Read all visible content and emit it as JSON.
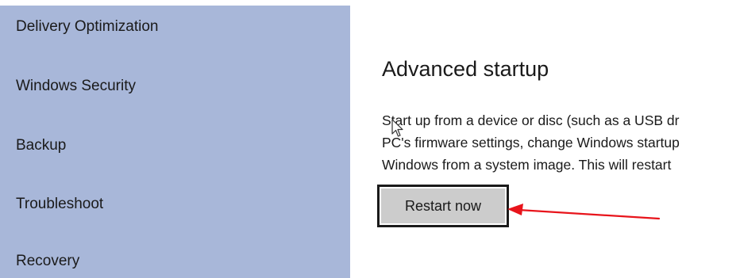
{
  "sidebar": {
    "items": [
      {
        "label": "Delivery Optimization"
      },
      {
        "label": "Windows Security"
      },
      {
        "label": "Backup"
      },
      {
        "label": "Troubleshoot"
      },
      {
        "label": "Recovery"
      }
    ]
  },
  "main": {
    "section_title": "Advanced startup",
    "description_lines": [
      "Start up from a device or disc (such as a USB dr",
      "PC's firmware settings, change Windows startup",
      "Windows from a system image. This will restart"
    ],
    "restart_button_label": "Restart now"
  },
  "colors": {
    "sidebar_background": "#a8b7d9",
    "annotation_arrow": "#e8141b",
    "button_background": "#cccccc"
  },
  "icons": {
    "cursor": "mouse-pointer-icon",
    "annotation": "red-arrow-icon"
  }
}
